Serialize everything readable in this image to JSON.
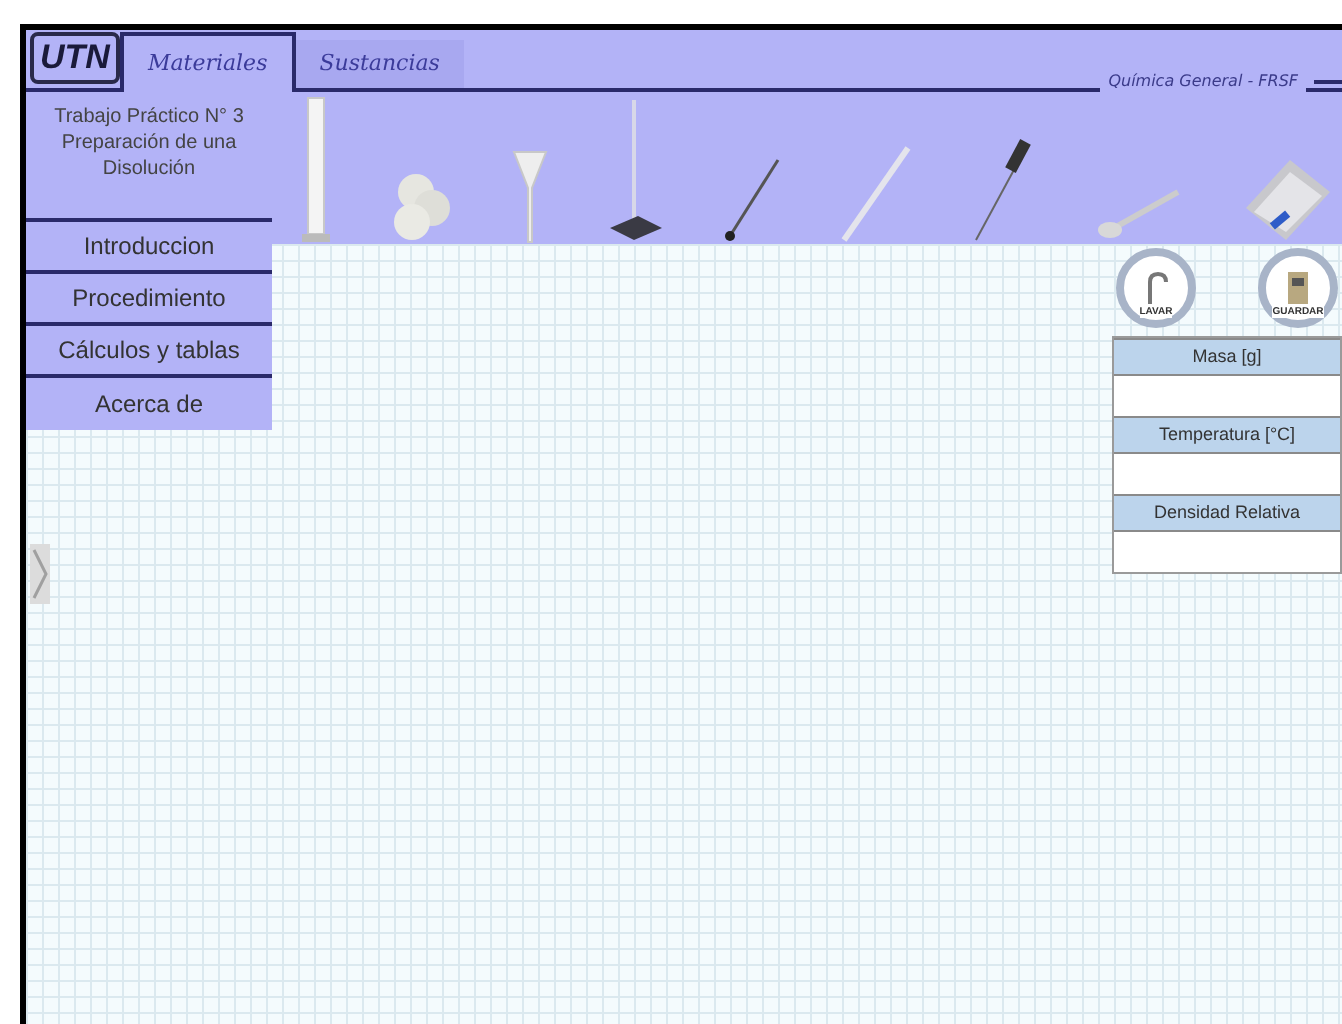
{
  "header": {
    "logo": "UTN",
    "subtitle": "Química General - FRSF",
    "tabs": [
      {
        "label": "Materiales",
        "selected": true
      },
      {
        "label": "Sustancias",
        "selected": false
      }
    ]
  },
  "sidebar": {
    "title": "Trabajo Práctico N° 3 Preparación de una Disolución",
    "items": [
      {
        "label": "Introduccion"
      },
      {
        "label": "Procedimiento"
      },
      {
        "label": "Cálculos y tablas"
      },
      {
        "label": "Acerca de"
      }
    ]
  },
  "tools": [
    {
      "kind": "cylinder"
    },
    {
      "kind": "papers"
    },
    {
      "kind": "funnel"
    },
    {
      "kind": "stand"
    },
    {
      "kind": "rod"
    },
    {
      "kind": "pipette"
    },
    {
      "kind": "thermometer"
    },
    {
      "kind": "spatula"
    },
    {
      "kind": "scale"
    }
  ],
  "actions": [
    {
      "kind": "wash",
      "label": "LAVAR"
    },
    {
      "kind": "save",
      "label": "GUARDAR"
    }
  ],
  "table": {
    "rows": [
      {
        "header": "Masa [g]"
      },
      {
        "header": "Temperatura [°C]"
      },
      {
        "header": "Densidad Relativa"
      }
    ]
  }
}
